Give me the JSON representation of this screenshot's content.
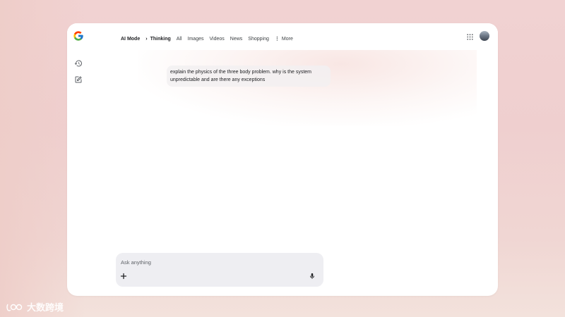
{
  "header": {
    "logo_icon": "google-g-icon",
    "breadcrumb": {
      "mode": "AI Mode",
      "separator": "›",
      "state": "Thinking"
    },
    "tabs": [
      {
        "label": "All"
      },
      {
        "label": "Images"
      },
      {
        "label": "Videos"
      },
      {
        "label": "News"
      },
      {
        "label": "Shopping"
      }
    ],
    "more": {
      "icon": "vertical-dots-icon",
      "label": "More"
    },
    "apps_icon": "grid-apps-icon",
    "avatar": "user-avatar"
  },
  "sidebar": {
    "icons": [
      "history-icon",
      "new-chat-edit-icon"
    ]
  },
  "conversation": {
    "user_message": "explain the physics of the three body problem. why is the system unpredictable and are there any exceptions"
  },
  "composer": {
    "placeholder": "Ask anything",
    "add_icon": "plus-icon",
    "mic_icon": "microphone-icon"
  },
  "watermark": {
    "text": "大数跨境"
  },
  "colors": {
    "background": "#efcfcf",
    "window": "#ffffff",
    "composer": "#eeeef2",
    "text": "#202124",
    "muted_text": "#5f6368"
  }
}
